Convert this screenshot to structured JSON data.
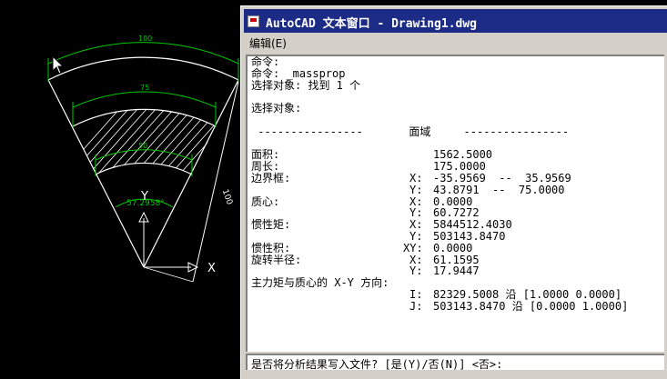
{
  "drawing": {
    "dim_outer": "100",
    "dim_middle": "75",
    "dim_inner": "50",
    "dim_side": "100",
    "angle": "57.2958°",
    "ucs_y": "Y",
    "ucs_x": "X"
  },
  "window": {
    "title": "AutoCAD 文本窗口 - Drawing1.dwg",
    "menu_edit": "编辑(E)"
  },
  "text_lines": [
    [
      "命令:"
    ],
    [
      "命令: _massprop"
    ],
    [
      "选择对象: 找到 1 个"
    ],
    [
      ""
    ],
    [
      "选择对象:"
    ],
    [
      ""
    ],
    [
      " ----------------       面域     ----------------"
    ],
    [
      ""
    ],
    [
      "面积:",
      "1562.5000"
    ],
    [
      "周长:",
      "175.0000"
    ],
    [
      "边界框:",
      "X:",
      "-35.9569  --  35.9569"
    ],
    [
      "",
      "Y:",
      "43.8791  --  75.0000"
    ],
    [
      "质心:",
      "X:",
      "0.0000"
    ],
    [
      "",
      "Y:",
      "60.7272"
    ],
    [
      "惯性矩:",
      "X:",
      "5844512.4030"
    ],
    [
      "",
      "Y:",
      "503143.8470"
    ],
    [
      "惯性积:",
      "XY:",
      "0.0000"
    ],
    [
      "旋转半径:",
      "X:",
      "61.1595"
    ],
    [
      "",
      "Y:",
      "17.9447"
    ],
    [
      "主力矩与质心的 X-Y 方向:"
    ],
    [
      "",
      "I:",
      "82329.5008 沿 [1.0000 0.0000]"
    ],
    [
      "",
      "J:",
      "503143.8470 沿 [0.0000 1.0000]"
    ]
  ],
  "command_prompt": "是否将分析结果写入文件? [是(Y)/否(N)] <否>:",
  "colors": {
    "title_bar": "#1c2c86",
    "dim_green": "#00c800",
    "geometry": "#ffffff"
  }
}
